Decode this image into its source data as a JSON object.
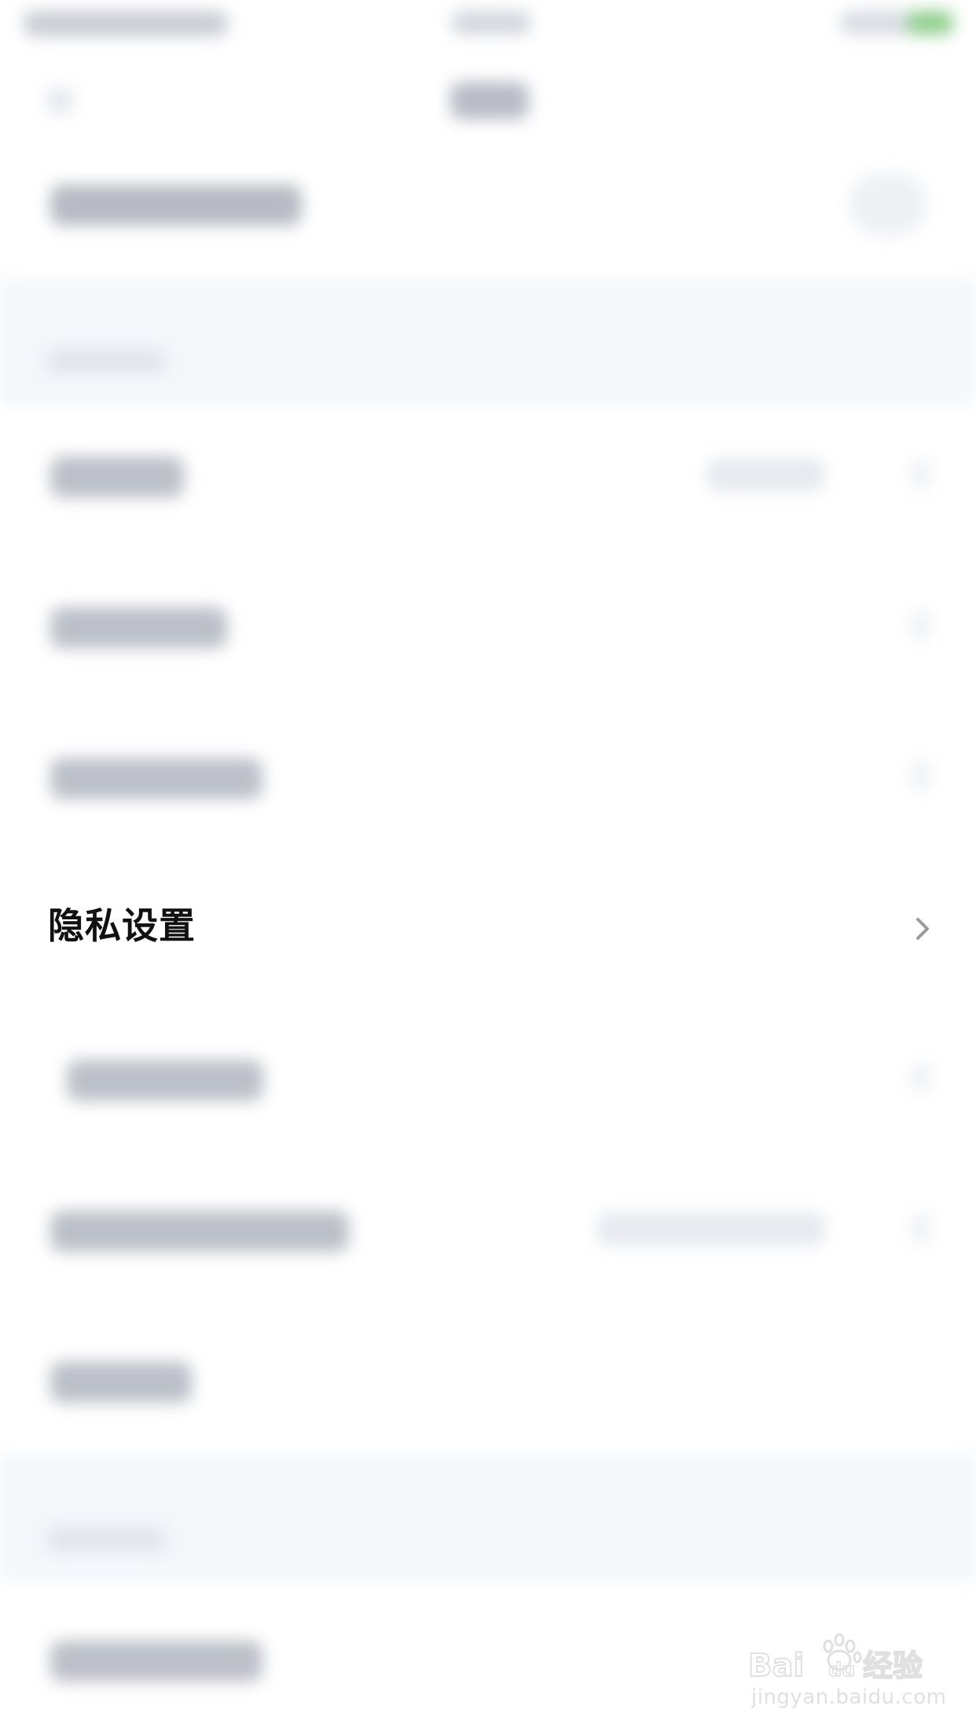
{
  "privacy_row": {
    "label": "隐私设置",
    "chevron_icon": "chevron-right-icon"
  },
  "watermark": {
    "brand": "Baidu经验",
    "url": "jingyan.baidu.com"
  },
  "colors": {
    "section_background": "#f4f6fa",
    "primary_text": "#111111",
    "chevron": "#9a9a9a",
    "battery": "#8fcf8c"
  }
}
